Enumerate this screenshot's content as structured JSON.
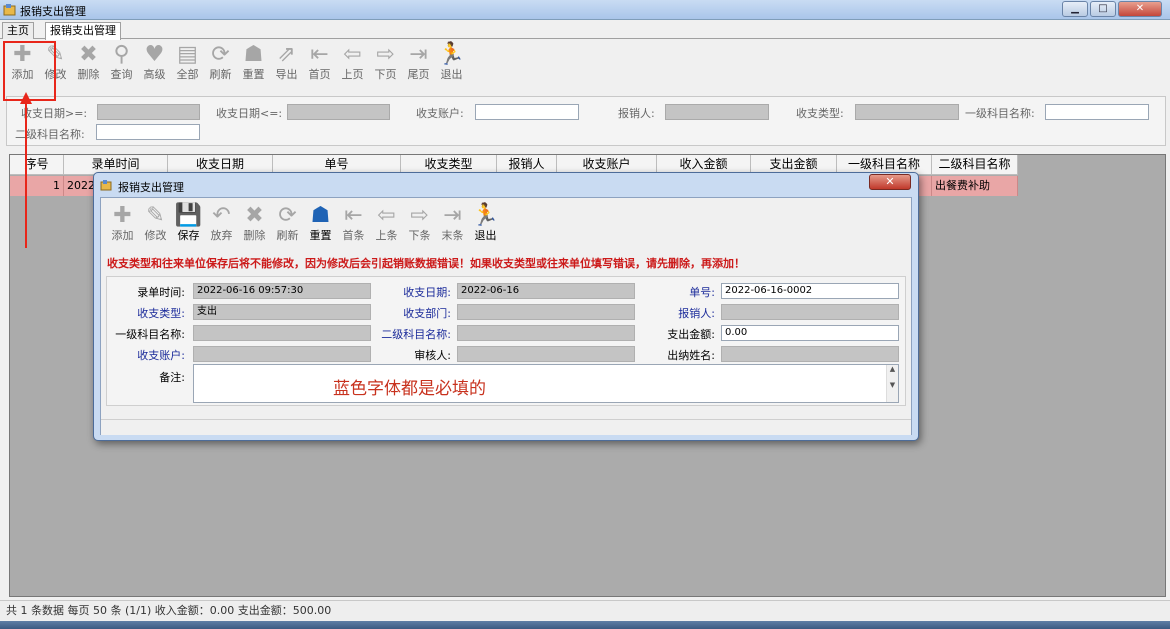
{
  "window": {
    "title": "报销支出管理",
    "min": "▁",
    "max": "□",
    "close": "✕"
  },
  "tabs": [
    "主页",
    "报销支出管理"
  ],
  "toolbar": [
    {
      "label": "添加",
      "icon": "plus-icon",
      "glyph": "✚"
    },
    {
      "label": "修改",
      "icon": "edit-icon",
      "glyph": "✎"
    },
    {
      "label": "删除",
      "icon": "delete-icon",
      "glyph": "✖"
    },
    {
      "label": "查询",
      "icon": "search-icon",
      "glyph": "⚲"
    },
    {
      "label": "高级",
      "icon": "advanced-search-icon",
      "glyph": "♥"
    },
    {
      "label": "全部",
      "icon": "all-icon",
      "glyph": "▤"
    },
    {
      "label": "刷新",
      "icon": "refresh-icon",
      "glyph": "⟳"
    },
    {
      "label": "重置",
      "icon": "reset-icon",
      "glyph": "☗"
    },
    {
      "label": "导出",
      "icon": "export-icon",
      "glyph": "⇗"
    },
    {
      "label": "首页",
      "icon": "first-page-icon",
      "glyph": "⇤"
    },
    {
      "label": "上页",
      "icon": "prev-page-icon",
      "glyph": "⇦"
    },
    {
      "label": "下页",
      "icon": "next-page-icon",
      "glyph": "⇨"
    },
    {
      "label": "尾页",
      "icon": "last-page-icon",
      "glyph": "⇥"
    },
    {
      "label": "退出",
      "icon": "exit-icon",
      "glyph": "🏃"
    }
  ],
  "filter": {
    "date_from": "收支日期>=:",
    "date_to": "收支日期<=:",
    "account": "收支账户:",
    "reporter": "报销人:",
    "type": "收支类型:",
    "level1": "一级科目名称:",
    "level2": "二级科目名称:"
  },
  "grid": {
    "columns": [
      "序号",
      "录单时间",
      "收支日期",
      "单号",
      "收支类型",
      "报销人",
      "收支账户",
      "收入金额",
      "支出金额",
      "一级科目名称",
      "二级科目名称"
    ],
    "rows": [
      [
        "1",
        "2022-",
        "",
        "",
        "",
        "",
        "",
        "",
        "",
        "",
        "出餐费补助"
      ]
    ]
  },
  "status": "共 1 条数据  每页 50 条  (1/1)  收入金额：0.00  支出金额：500.00",
  "dialog": {
    "title": "报销支出管理",
    "close": "✕",
    "toolbar": [
      {
        "label": "添加",
        "icon": "plus-icon",
        "glyph": "✚",
        "on": false
      },
      {
        "label": "修改",
        "icon": "edit-icon",
        "glyph": "✎",
        "on": false
      },
      {
        "label": "保存",
        "icon": "save-icon",
        "glyph": "💾",
        "on": true
      },
      {
        "label": "放弃",
        "icon": "undo-icon",
        "glyph": "↶",
        "on": false
      },
      {
        "label": "删除",
        "icon": "delete-icon",
        "glyph": "✖",
        "on": false
      },
      {
        "label": "刷新",
        "icon": "refresh-icon",
        "glyph": "⟳",
        "on": false
      },
      {
        "label": "重置",
        "icon": "reset-icon",
        "glyph": "☗",
        "on": true
      },
      {
        "label": "首条",
        "icon": "first-record-icon",
        "glyph": "⇤",
        "on": false
      },
      {
        "label": "上条",
        "icon": "prev-record-icon",
        "glyph": "⇦",
        "on": false
      },
      {
        "label": "下条",
        "icon": "next-record-icon",
        "glyph": "⇨",
        "on": false
      },
      {
        "label": "末条",
        "icon": "last-record-icon",
        "glyph": "⇥",
        "on": false
      },
      {
        "label": "退出",
        "icon": "exit-icon",
        "glyph": "🏃",
        "on": true
      }
    ],
    "warning": "收支类型和往来单位保存后将不能修改，因为修改后会引起销账数据错误！如果收支类型或往来单位填写错误，请先删除，再添加！",
    "fields": {
      "entry_time_label": "录单时间:",
      "entry_time_value": "2022-06-16 09:57:30",
      "date_label": "收支日期:",
      "date_value": "2022-06-16",
      "number_label": "单号:",
      "number_value": "2022-06-16-0002",
      "type_label": "收支类型:",
      "type_value": "支出",
      "dept_label": "收支部门:",
      "reporter_label": "报销人:",
      "level1_label": "一级科目名称:",
      "level2_label": "二级科目名称:",
      "amount_label": "支出金额:",
      "amount_value": "0.00",
      "account_label": "收支账户:",
      "auditor_label": "审核人:",
      "cashier_label": "出纳姓名:",
      "memo_label": "备注:"
    },
    "hint": "蓝色字体都是必填的"
  },
  "colors": {
    "required": "#1a2a9a",
    "warning": "#cc1a1a",
    "annotation": "#e8261a",
    "selected_row": "#e9a6a6"
  }
}
